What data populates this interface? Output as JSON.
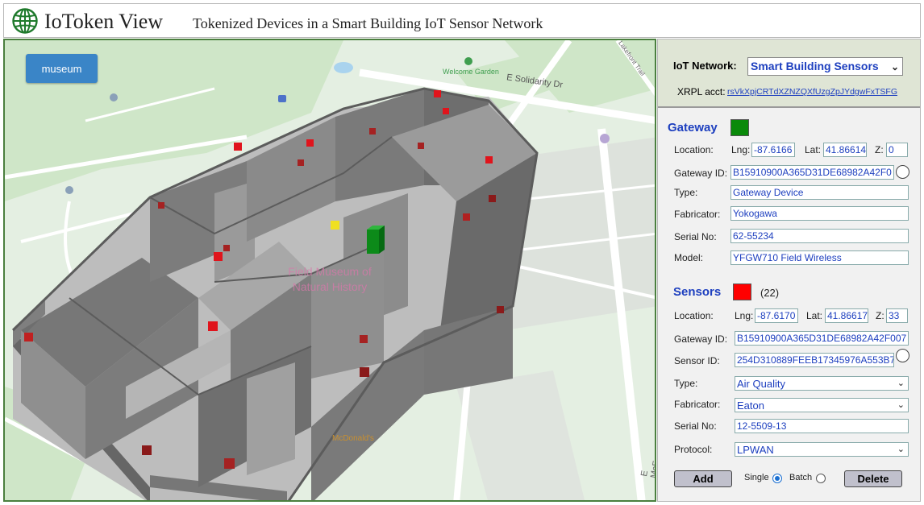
{
  "header": {
    "title": "IoToken View",
    "subtitle": "Tokenized Devices in a Smart Building IoT Sensor Network"
  },
  "map": {
    "button_label": "museum",
    "labels": {
      "welcome_garden": "Welcome Garden",
      "street": "E Solidarity Dr",
      "trail": "Lakefront Trail",
      "poi": "Field Museum of Natural History",
      "restaurant": "McDonald's",
      "side_street": "E McF"
    },
    "colors": {
      "ground": "#e3efe3",
      "park": "#cfe6c8",
      "road": "#ffffff",
      "wall": "#7b7b7b",
      "sensor": "#e0141c",
      "gateway": "#0c8a19",
      "relay": "#f0e020"
    }
  },
  "panel": {
    "network": {
      "label": "IoT Network:",
      "selected": "Smart Building Sensors",
      "acct_label": "XRPL acct:",
      "acct_value": "rsVkXpjCRTdXZNZQXfUzgZpJYdgwFxTSFG"
    },
    "gateway": {
      "title": "Gateway",
      "swatch_color": "#0a8a0a",
      "location_label": "Location:",
      "lng_label": "Lng:",
      "lng": "-87.6166",
      "lat_label": "Lat:",
      "lat": "41.86614",
      "z_label": "Z:",
      "z": "0",
      "id_label": "Gateway ID:",
      "id": "B15910900A365D31DE68982A42F0",
      "type_label": "Type:",
      "type": "Gateway Device",
      "fab_label": "Fabricator:",
      "fab": "Yokogawa",
      "serial_label": "Serial No:",
      "serial": "62-55234",
      "model_label": "Model:",
      "model": "YFGW710 Field Wireless"
    },
    "sensors": {
      "title": "Sensors",
      "swatch_color": "#ff0000",
      "count": "(22)",
      "location_label": "Location:",
      "lng_label": "Lng:",
      "lng": "-87.6170",
      "lat_label": "Lat:",
      "lat": "41.86617",
      "z_label": "Z:",
      "z": "33",
      "gw_label": "Gateway ID:",
      "gw": "B15910900A365D31DE68982A42F007",
      "sid_label": "Sensor ID:",
      "sid": "254D310889FEEB17345976A553B7",
      "type_label": "Type:",
      "type": "Air Quality",
      "fab_label": "Fabricator:",
      "fab": "Eaton",
      "serial_label": "Serial No:",
      "serial": "12-5509-13",
      "protocol_label": "Protocol:",
      "protocol": "LPWAN"
    },
    "actions": {
      "add": "Add",
      "single": "Single",
      "batch": "Batch",
      "delete": "Delete",
      "mode": "single"
    }
  }
}
